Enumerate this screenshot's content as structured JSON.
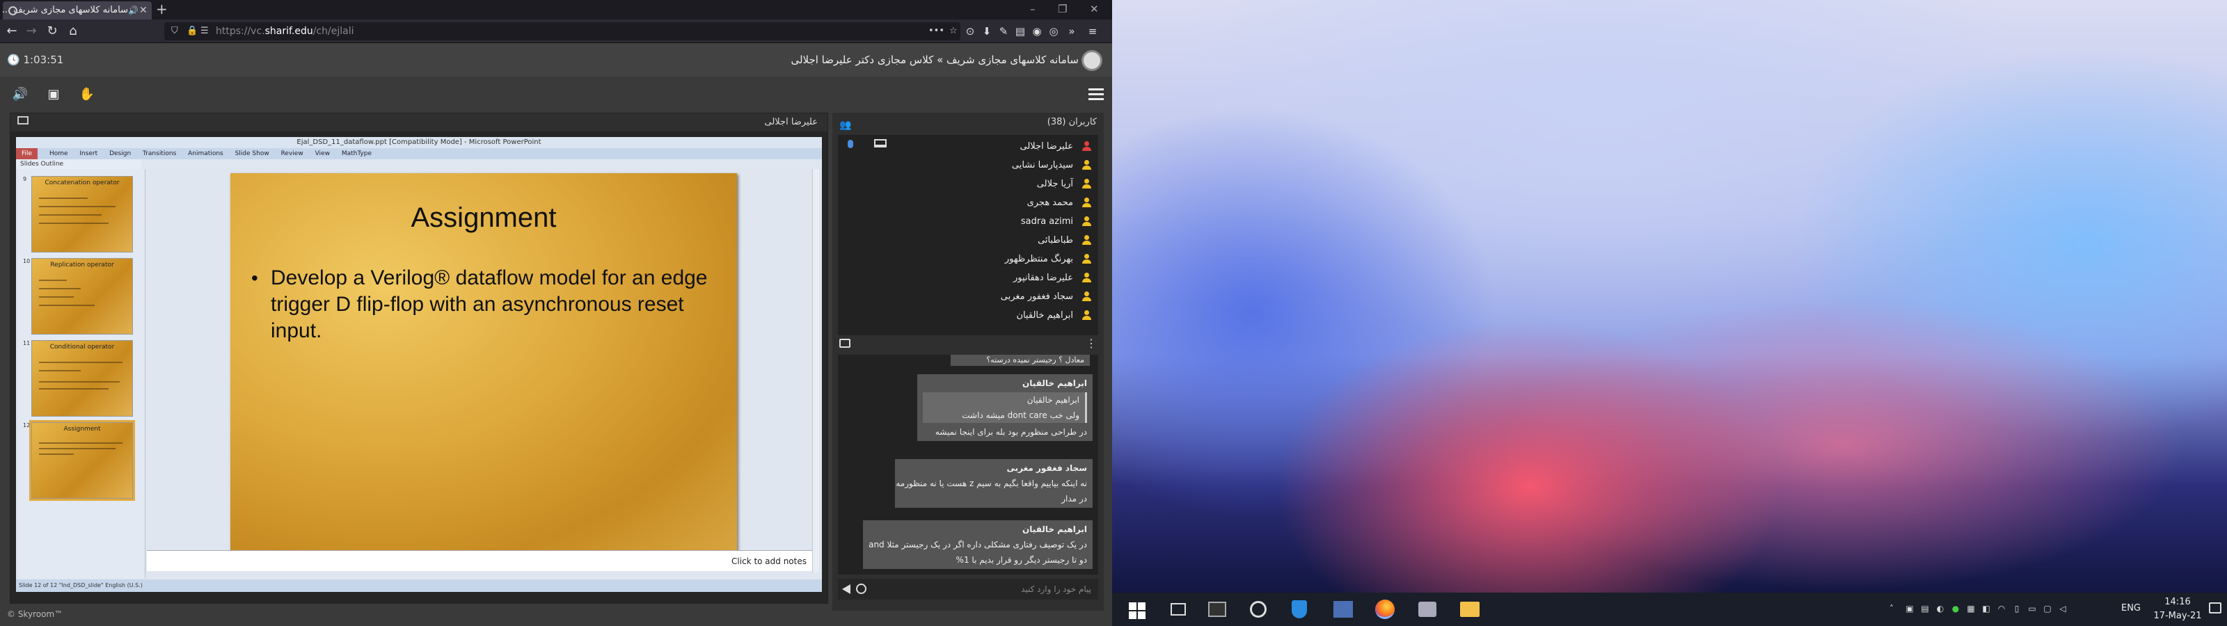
{
  "browser": {
    "tab_title": "سامانه کلاسهای مجازی شریف ...",
    "url_prefix": "https://vc.",
    "url_domain": "sharif.edu",
    "url_path": "/ch/ejlali"
  },
  "app": {
    "timer": "1:03:51",
    "breadcrumb": "سامانه کلاسهای مجازی شریف » کلاس مجازی دکتر علیرضا اجلالی",
    "presenter_name": "علیرضا اجلالی",
    "users_title": "کاربران (38)",
    "footer": "© Skyroom™"
  },
  "ppt": {
    "window_title": "Ejal_DSD_11_dataflow.ppt [Compatibility Mode] - Microsoft PowerPoint",
    "ribbon": [
      "File",
      "Home",
      "Insert",
      "Design",
      "Transitions",
      "Animations",
      "Slide Show",
      "Review",
      "View",
      "MathType"
    ],
    "panel_tabs": "Slides    Outline",
    "thumbnails": [
      {
        "num": "9",
        "title": "Concatenation operator"
      },
      {
        "num": "10",
        "title": "Replication operator"
      },
      {
        "num": "11",
        "title": "Conditional operator"
      },
      {
        "num": "12",
        "title": "Assignment"
      }
    ],
    "slide_title": "Assignment",
    "slide_body": "Develop a Verilog® dataflow model for an edge trigger D flip-flop with an asynchronous reset input.",
    "notes_placeholder": "Click to add notes",
    "status_bar": "Slide 12 of 12    \"Ind_DSD_slide\"    English (U.S.)"
  },
  "users": [
    {
      "name": "علیرضا اجلالی",
      "color": "#e04040"
    },
    {
      "name": "سیدپارسا نشایی",
      "color": "#f0c020"
    },
    {
      "name": "آریا جلالی",
      "color": "#f0c020"
    },
    {
      "name": "محمد هجری",
      "color": "#f0c020"
    },
    {
      "name": "sadra azimi",
      "color": "#f0c020"
    },
    {
      "name": "طباطبائی",
      "color": "#f0c020"
    },
    {
      "name": "بهرنگ منتظرظهور",
      "color": "#f0c020"
    },
    {
      "name": "علیرضا دهقانپور",
      "color": "#f0c020"
    },
    {
      "name": "سجاد فغفور مغربی",
      "color": "#f0c020"
    },
    {
      "name": "ابراهیم خالقیان",
      "color": "#f0c020"
    }
  ],
  "chat": {
    "partial_top": "معادل ؟ رجیستر نمیده درسته؟",
    "messages": [
      {
        "author": "ابراهیم خالقیان",
        "quote_author": "ابراهیم خالقیان",
        "quote": "ولی خب dont care میشه داشت",
        "text": "در طراحی منظورم بود بله برای اینجا نمیشه"
      },
      {
        "author": "سجاد فغفور مغربی",
        "text_lines": [
          "نه اینکه بیاییم واقعا بگیم به سیم z هست یا نه منظورمه",
          "در مدار"
        ]
      },
      {
        "author": "ابراهیم خالقیان",
        "text_lines": [
          "در یک توصیف رفتاری مشکلی داره اگر در یک رجیستر مثلا and",
          "دو تا رجیستر دیگر رو قرار بدیم با 1%"
        ]
      }
    ],
    "input_placeholder": "پیام خود را وارد کنید"
  },
  "taskbar": {
    "language": "ENG",
    "time": "14:16",
    "date": "17-May-21"
  }
}
